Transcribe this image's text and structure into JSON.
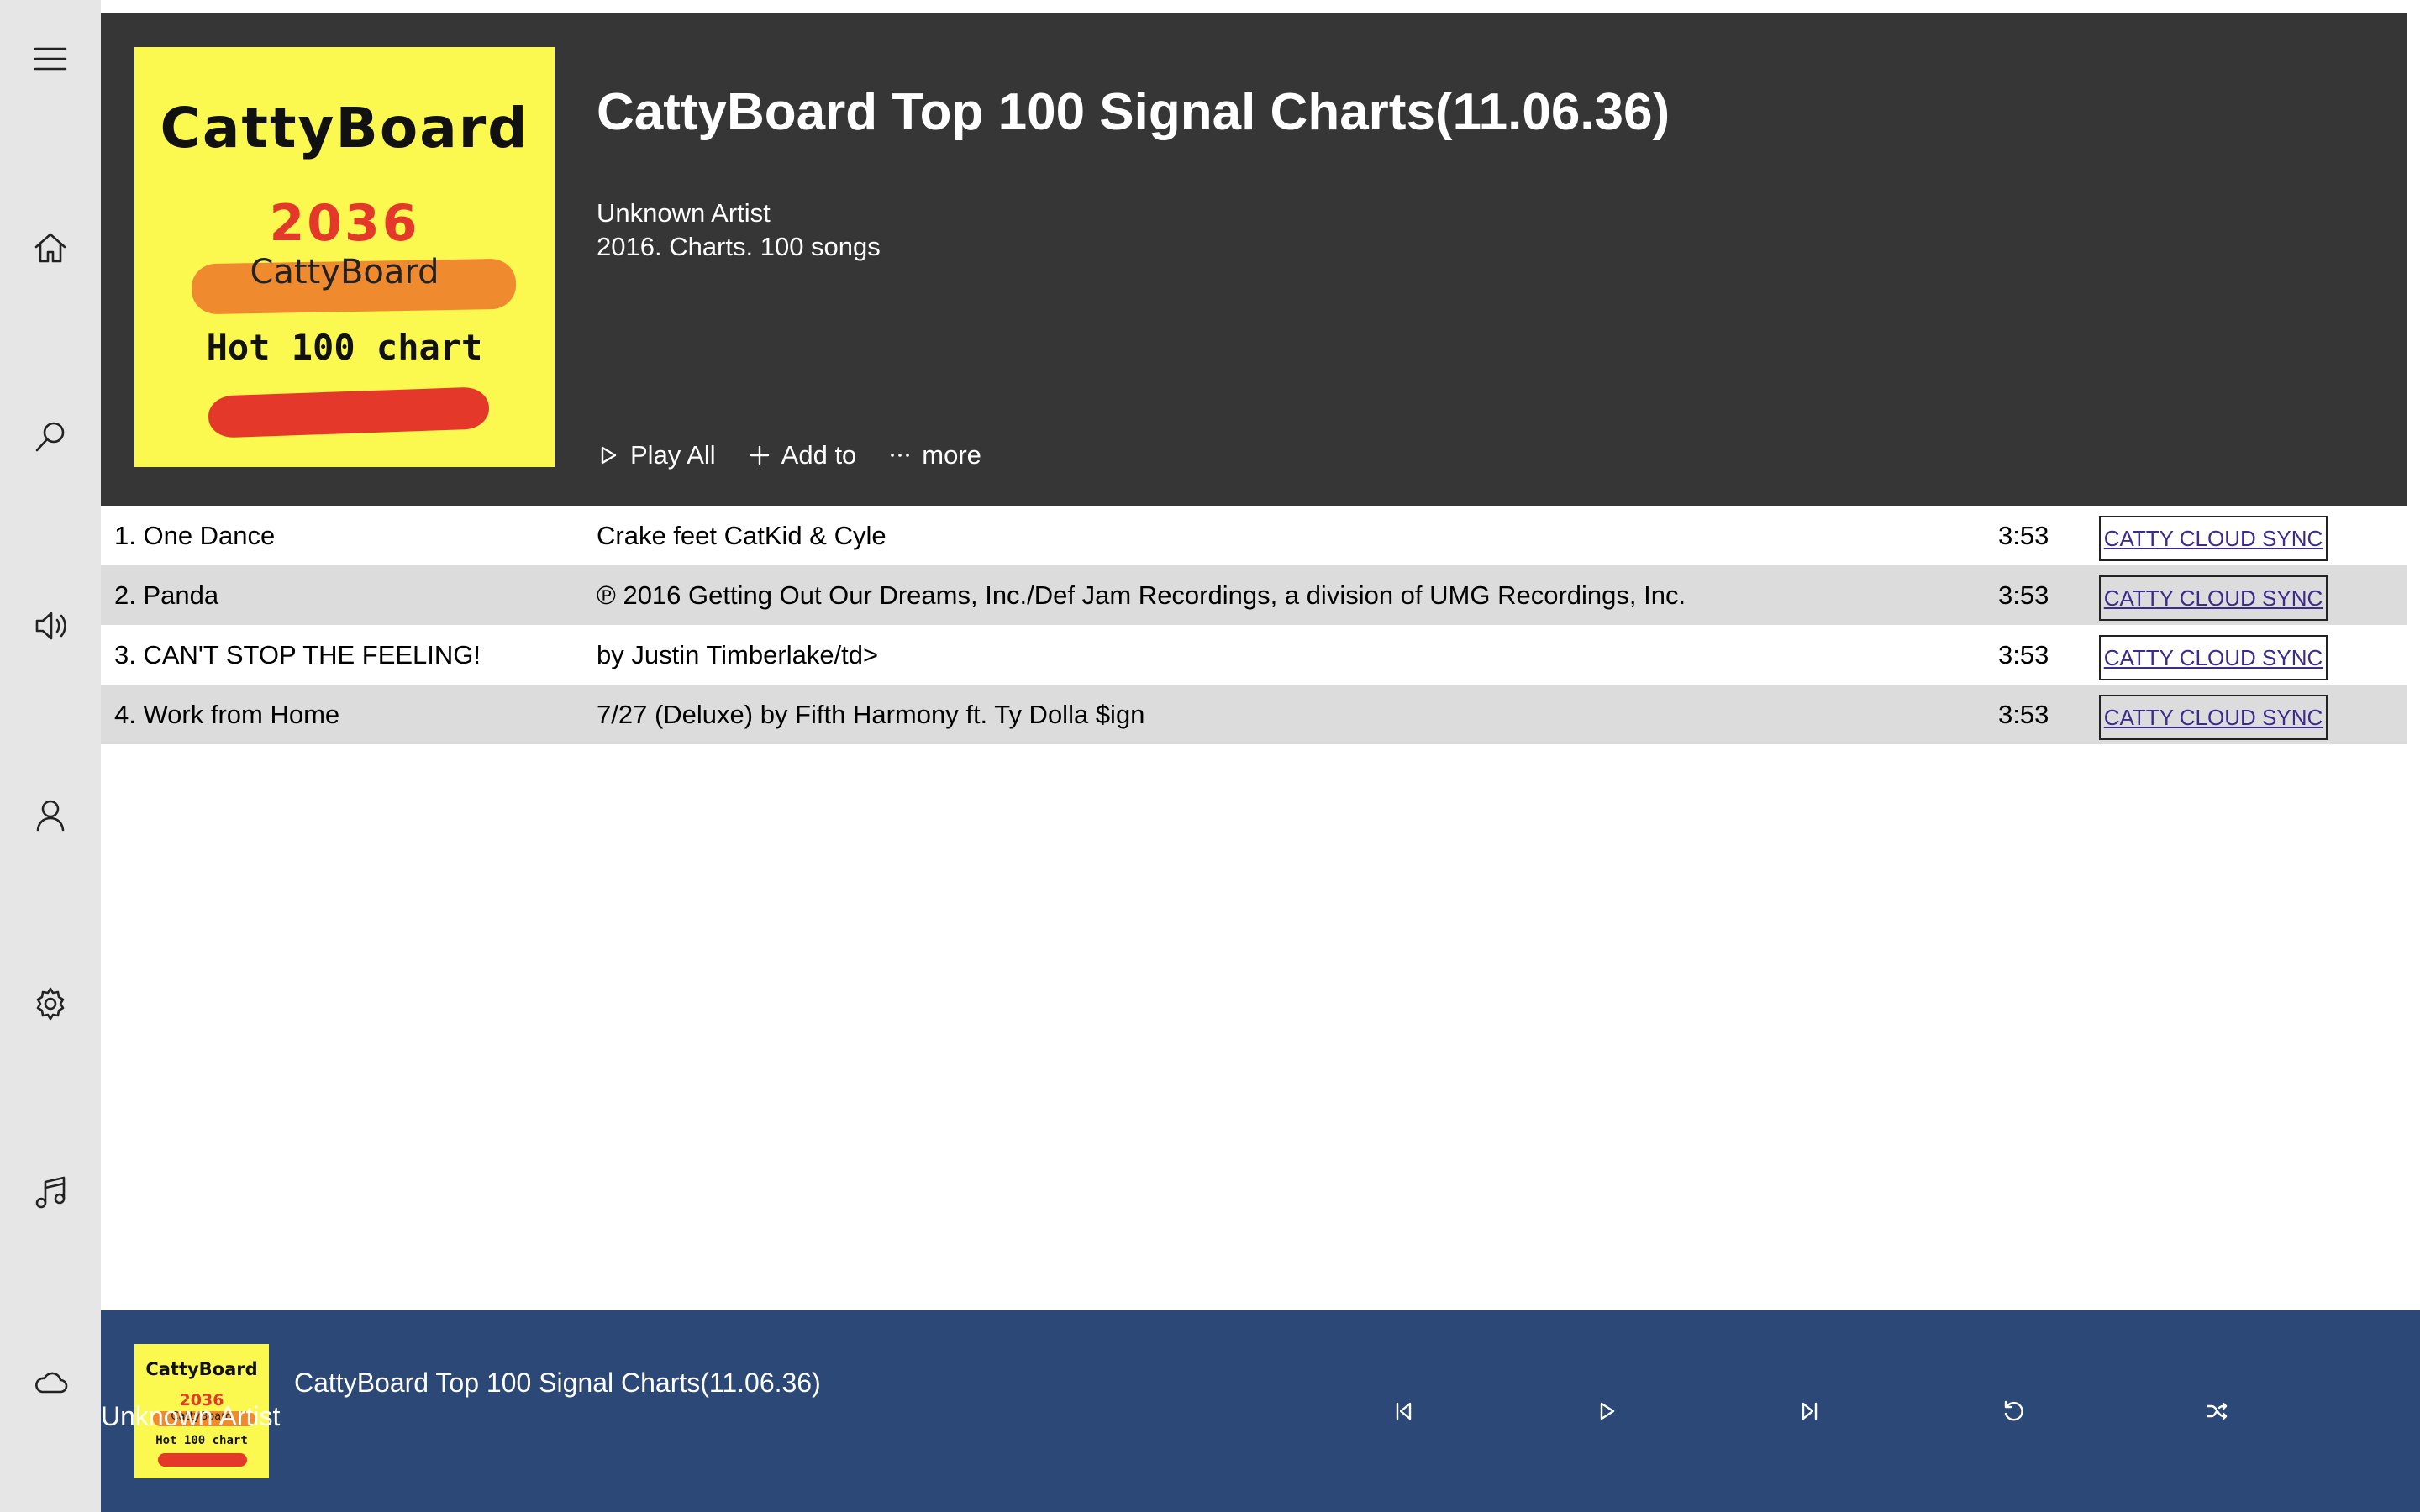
{
  "sidebar": {
    "items": [
      {
        "name": "menu",
        "icon": "hamburger-menu-icon"
      },
      {
        "name": "home",
        "icon": "home-icon"
      },
      {
        "name": "search",
        "icon": "search-icon"
      },
      {
        "name": "volume",
        "icon": "speaker-icon"
      },
      {
        "name": "account",
        "icon": "user-icon"
      },
      {
        "name": "settings",
        "icon": "gear-icon"
      },
      {
        "name": "music",
        "icon": "music-note-icon"
      },
      {
        "name": "cloud",
        "icon": "cloud-icon"
      }
    ]
  },
  "album": {
    "cover": {
      "title": "CattyBoard",
      "year": "2036",
      "subtitle": "CattyBoard",
      "chart": "Hot 100 chart"
    },
    "title": "CattyBoard Top 100 Signal Charts(11.06.36)",
    "artist": "Unknown Artist",
    "info": "2016. Charts. 100 songs"
  },
  "actions": {
    "play_all": "Play All",
    "add_to": "Add to",
    "more": "more"
  },
  "tracks": [
    {
      "name": "1. One Dance",
      "artist": "Crake feet CatKid & Cyle",
      "duration": "3:53",
      "sync_label": "CATTY CLOUD SYNC"
    },
    {
      "name": "2. Panda",
      "artist": "℗ 2016 Getting Out Our Dreams, Inc./Def Jam Recordings, a division of UMG Recordings, Inc.",
      "duration": "3:53",
      "sync_label": "CATTY CLOUD SYNC"
    },
    {
      "name": "3. CAN'T STOP THE FEELING!",
      "artist": "by Justin Timberlake/td>",
      "duration": "3:53",
      "sync_label": "CATTY CLOUD SYNC"
    },
    {
      "name": "4. Work from Home",
      "artist": "7/27 (Deluxe) by Fifth Harmony ft. Ty Dolla $ign",
      "duration": "3:53",
      "sync_label": "CATTY CLOUD SYNC"
    }
  ],
  "player": {
    "title": "CattyBoard Top 100 Signal Charts(11.06.36)",
    "artist": "Unknown Artist",
    "controls": [
      "previous-icon",
      "play-icon",
      "next-icon",
      "repeat-icon",
      "shuffle-icon"
    ]
  },
  "colors": {
    "sidebar_bg": "#e6e6e6",
    "header_bg": "#363636",
    "player_bg": "#2c4876",
    "row_alt_bg": "#dcdcdc",
    "cover_yellow": "#fbf850",
    "cover_red": "#e4392a",
    "cover_orange": "#f08a2e",
    "link_color": "#3c2a8c"
  }
}
